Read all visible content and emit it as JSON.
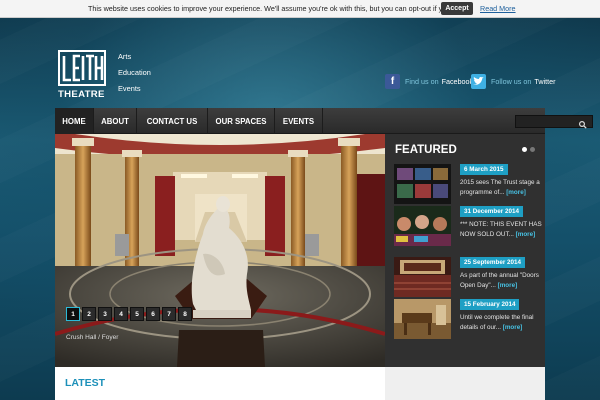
{
  "cookie": {
    "text": "This website uses cookies to improve your experience. We'll assume you're ok with this, but you can opt-out if you wish.",
    "accept_label": "Accept",
    "more_label": "Read More"
  },
  "logo": {
    "letters": "LEITH",
    "word": "THEATRE",
    "menu": [
      "Arts",
      "Education",
      "Events"
    ]
  },
  "social": {
    "facebook": {
      "pre": "Find us on",
      "post": "Facebook",
      "icon": "facebook-icon"
    },
    "twitter": {
      "pre": "Follow us on",
      "post": "Twitter",
      "icon": "twitter-icon"
    }
  },
  "nav": {
    "items": [
      "HOME",
      "ABOUT",
      "CONTACT US",
      "OUR SPACES",
      "EVENTS"
    ],
    "search_placeholder": ""
  },
  "hero": {
    "slides": [
      "1",
      "2",
      "3",
      "4",
      "5",
      "6",
      "7",
      "8"
    ],
    "active_slide": 1,
    "caption": "Crush Hall / Foyer"
  },
  "featured": {
    "title": "FEATURED",
    "items": [
      {
        "date": "6 March 2015",
        "text": "2015 sees The Trust stage a programme of...",
        "more": "[more]"
      },
      {
        "date": "31 December 2014",
        "text": "*** NOTE: THIS EVENT HAS NOW SOLD OUT...",
        "more": "[more]"
      },
      {
        "date": "25 September 2014",
        "text": "As part of the annual \"Doors Open Day\"...",
        "more": "[more]"
      },
      {
        "date": "15 February 2014",
        "text": "Until we complete the final details of our...",
        "more": "[more]"
      }
    ]
  },
  "latest": {
    "title": "LATEST"
  },
  "colors": {
    "accent": "#1e9fc4",
    "nav": "#333333",
    "background": "#14506a"
  }
}
